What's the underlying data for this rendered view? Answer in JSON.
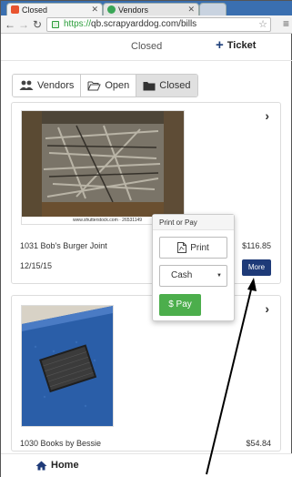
{
  "browser": {
    "tabs": [
      {
        "title": "Closed",
        "favicon_color": "#e8542f"
      },
      {
        "title": "Vendors",
        "favicon_color": "#3aa657"
      }
    ],
    "url_scheme": "https://",
    "url_rest": "qb.scrapyarddog.com/bills"
  },
  "header": {
    "title": "Closed",
    "ticket_label": "Ticket"
  },
  "filters": [
    {
      "label": "Vendors",
      "active": false
    },
    {
      "label": "Open",
      "active": false
    },
    {
      "label": "Closed",
      "active": true
    }
  ],
  "bills": [
    {
      "name": "1031 Bob's Burger Joint",
      "amount": "$116.85",
      "date": "12/15/15",
      "photo_caption": "www.shutterstock.com · 26531149"
    },
    {
      "name": "1030 Books by Bessie",
      "amount": "$54.84"
    }
  ],
  "popover": {
    "title": "Print or Pay",
    "print_label": "Print",
    "payment_method": "Cash",
    "pay_label": "$ Pay"
  },
  "more_label": "More",
  "footer": {
    "home_label": "Home"
  },
  "colors": {
    "primary_navy": "#1e3a78",
    "pay_green": "#4cae4c",
    "tab_strip": "#3a6fb0"
  }
}
